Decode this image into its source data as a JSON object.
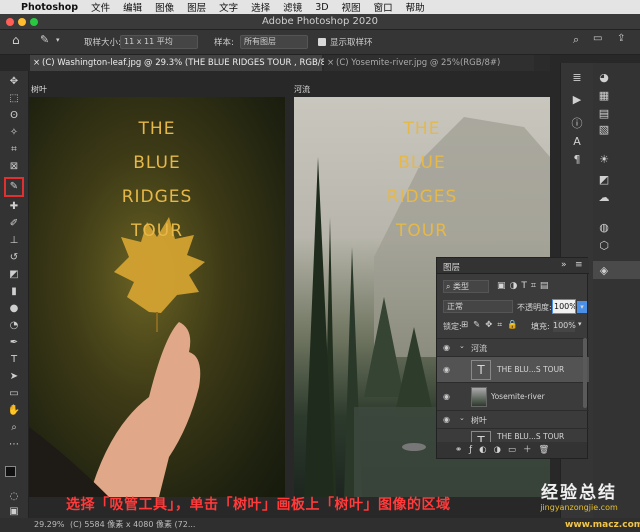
{
  "menubar": {
    "app": "Photoshop",
    "items": [
      "文件",
      "编辑",
      "图像",
      "图层",
      "文字",
      "选择",
      "滤镜",
      "3D",
      "视图",
      "窗口",
      "帮助"
    ]
  },
  "titlebar": {
    "title": "Adobe Photoshop 2020"
  },
  "options": {
    "sample_size_label": "取样大小:",
    "sample_size_value": "11 x 11 平均",
    "sample_label": "样本:",
    "sample_value": "所有图层",
    "show_ring_label": "显示取样环"
  },
  "tabs": [
    "(C) Washington-leaf.jpg @ 29.3% (THE BLUE RIDGES TOUR , RGB/8#) *",
    "(C) Yosemite-river.jpg @ 25%(RGB/8#)"
  ],
  "artboards": {
    "left_label": "树叶",
    "right_label": "河流",
    "text_lines": [
      "THE",
      "BLUE",
      "RIDGES",
      "TOUR"
    ]
  },
  "layers_panel": {
    "title": "图层",
    "kind": "类型",
    "blend_mode": "正常",
    "opacity_label": "不透明度:",
    "opacity_value": "100%",
    "lock_label": "锁定:",
    "fill_label": "填充:",
    "fill_value": "100%",
    "groups": [
      {
        "name": "河流"
      },
      {
        "name": "树叶"
      }
    ],
    "layers": [
      "THE BLU...S TOUR",
      "Yosemite-river",
      "THE BLU...S TOUR"
    ]
  },
  "caption": "选择「吸管工具」，单击「树叶」画板上「树叶」图像的区域",
  "watermark": {
    "title": "经验总结",
    "url": "jingyanzongjie.com",
    "site": "www.macz.com"
  },
  "status": {
    "zoom": "29.29%",
    "info": "(C) 5584 像素 x 4080 像素 (72..."
  },
  "colors": {
    "accent": "#e6b848",
    "caption": "#ff3a3a",
    "highlight": "#e03030"
  }
}
